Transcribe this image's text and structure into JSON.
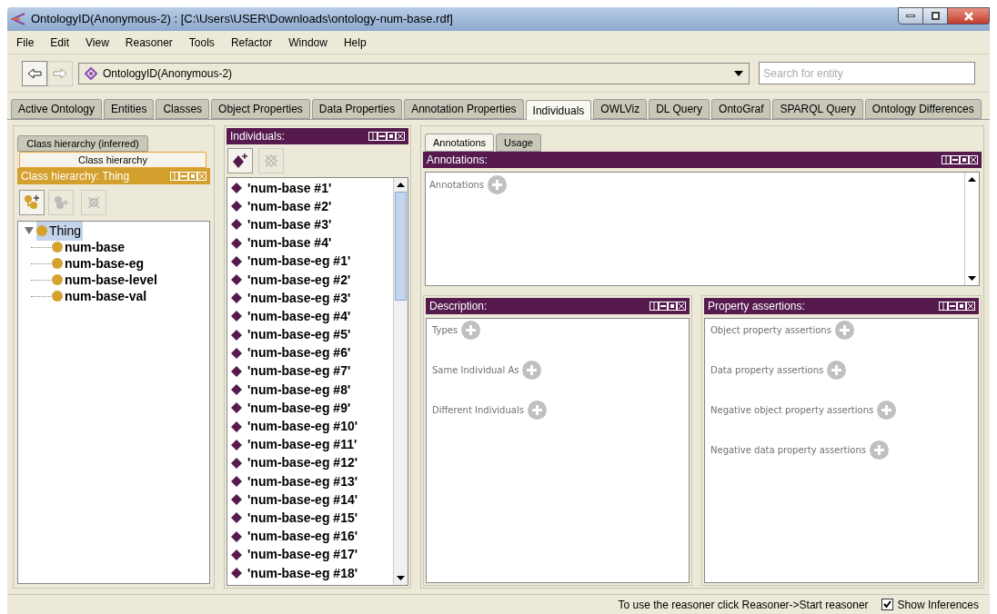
{
  "window": {
    "title": "OntologyID(Anonymous-2) : [C:\\Users\\USER\\Downloads\\ontology-num-base.rdf]"
  },
  "menu": [
    "File",
    "Edit",
    "View",
    "Reasoner",
    "Tools",
    "Refactor",
    "Window",
    "Help"
  ],
  "toolbar": {
    "ontology": "OntologyID(Anonymous-2)",
    "search": {
      "placeholder": "Search for entity"
    }
  },
  "tabs": [
    {
      "label": "Active Ontology",
      "selected": false
    },
    {
      "label": "Entities",
      "selected": false
    },
    {
      "label": "Classes",
      "selected": false
    },
    {
      "label": "Object Properties",
      "selected": false
    },
    {
      "label": "Data Properties",
      "selected": false
    },
    {
      "label": "Annotation Properties",
      "selected": false
    },
    {
      "label": "Individuals",
      "selected": true
    },
    {
      "label": "OWLViz",
      "selected": false
    },
    {
      "label": "DL Query",
      "selected": false
    },
    {
      "label": "OntoGraf",
      "selected": false
    },
    {
      "label": "SPARQL Query",
      "selected": false
    },
    {
      "label": "Ontology Differences",
      "selected": false
    }
  ],
  "class_panel": {
    "subtabs": [
      {
        "label": "Class hierarchy (inferred)",
        "selected": false
      },
      {
        "label": "Class hierarchy",
        "selected": true
      }
    ],
    "title": "Class hierarchy: Thing",
    "tree": [
      {
        "label": "Thing",
        "selected": true,
        "expanded": true,
        "children": [
          {
            "label": "num-base",
            "selected": false
          },
          {
            "label": "num-base-eg",
            "selected": false
          },
          {
            "label": "num-base-level",
            "selected": false
          },
          {
            "label": "num-base-val",
            "selected": false
          }
        ]
      }
    ]
  },
  "individuals_panel": {
    "title": "Individuals:",
    "items": [
      "'num-base #1'",
      "'num-base #2'",
      "'num-base #3'",
      "'num-base #4'",
      "'num-base-eg #1'",
      "'num-base-eg #2'",
      "'num-base-eg #3'",
      "'num-base-eg #4'",
      "'num-base-eg #5'",
      "'num-base-eg #6'",
      "'num-base-eg #7'",
      "'num-base-eg #8'",
      "'num-base-eg #9'",
      "'num-base-eg #10'",
      "'num-base-eg #11'",
      "'num-base-eg #12'",
      "'num-base-eg #13'",
      "'num-base-eg #14'",
      "'num-base-eg #15'",
      "'num-base-eg #16'",
      "'num-base-eg #17'",
      "'num-base-eg #18'"
    ]
  },
  "right_tabs": [
    {
      "label": "Annotations",
      "selected": true
    },
    {
      "label": "Usage",
      "selected": false
    }
  ],
  "annotations_panel": {
    "title": "Annotations:",
    "sections": [
      "Annotations"
    ]
  },
  "description_panel": {
    "title": "Description:",
    "sections": [
      "Types",
      "Same Individual As",
      "Different Individuals"
    ]
  },
  "property_panel": {
    "title": "Property assertions:",
    "sections": [
      "Object property assertions",
      "Data property assertions",
      "Negative object property assertions",
      "Negative data property assertions"
    ]
  },
  "status_bar": {
    "message": "To use the reasoner click Reasoner->Start reasoner",
    "show_inferences": {
      "label": "Show Inferences",
      "checked": true
    }
  }
}
